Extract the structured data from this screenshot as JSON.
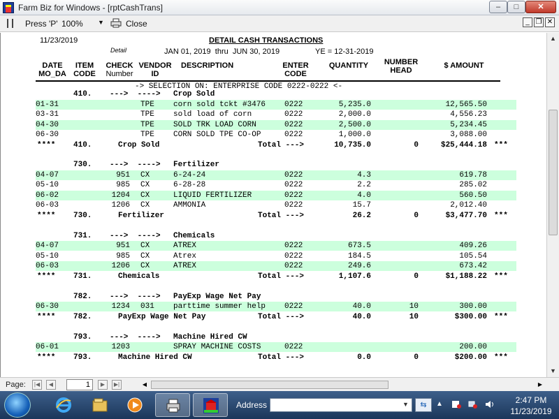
{
  "window": {
    "title": "Farm Biz for Windows - [rptCashTrans]",
    "min_glyph": "–",
    "max_glyph": "□",
    "close_glyph": "✕"
  },
  "toolbar": {
    "print_label": "Press 'P'",
    "zoom": "100%",
    "zoom_arrow": "▼",
    "close_label": "Close",
    "mdi_min": "_",
    "mdi_restore": "❐",
    "mdi_close": "✕"
  },
  "report": {
    "date": "11/23/2019",
    "title": "DETAIL CASH TRANSACTIONS",
    "detail_label": "Detail",
    "period": "JAN 01, 2019  thru  JUN 30, 2019",
    "ye": "YE = 12-31-2019",
    "headers": {
      "date": "DATE",
      "moda": "MO_DA",
      "item": "ITEM",
      "code": "CODE",
      "check": "CHECK",
      "number": "Number",
      "vendor": "VENDOR",
      "id": "ID",
      "description": "DESCRIPTION",
      "enter": "ENTER",
      "enter_code": "CODE",
      "quantity": "QUANTITY",
      "number_head_1": "NUMBER",
      "number_head_2": "HEAD",
      "amount": "$ AMOUNT"
    },
    "selection": "-> SELECTION ON: ENTERPRISE CODE 0222-0222 <-",
    "groups": [
      {
        "code": "410.",
        "arrows": "--->  ---->",
        "name": "Crop Sold",
        "rows": [
          {
            "date": "01-31",
            "check": "",
            "vendor": "TPE",
            "desc": "corn sold tckt #3476",
            "enter": "0222",
            "qty": "5,235.0",
            "head": "",
            "amount": "12,565.50",
            "band": true
          },
          {
            "date": "03-31",
            "check": "",
            "vendor": "TPE",
            "desc": "sold load of corn",
            "enter": "0222",
            "qty": "2,000.0",
            "head": "",
            "amount": "4,556.23",
            "band": false
          },
          {
            "date": "04-30",
            "check": "",
            "vendor": "TPE",
            "desc": "SOLD TRK LOAD CORN",
            "enter": "0222",
            "qty": "2,500.0",
            "head": "",
            "amount": "5,234.45",
            "band": true
          },
          {
            "date": "06-30",
            "check": "",
            "vendor": "TPE",
            "desc": "CORN SOLD TPE CO-OP",
            "enter": "0222",
            "qty": "1,000.0",
            "head": "",
            "amount": "3,088.00",
            "band": false
          }
        ],
        "total": {
          "stars": "****",
          "code": "410.",
          "name": "Crop Sold",
          "label": "Total --->",
          "qty": "10,735.0",
          "head": "0",
          "amount": "$25,444.18",
          "tail": "***"
        }
      },
      {
        "code": "730.",
        "arrows": "--->  ---->",
        "name": "Fertilizer",
        "rows": [
          {
            "date": "04-07",
            "check": "951",
            "vendor": "CX",
            "desc": "6-24-24",
            "enter": "0222",
            "qty": "4.3",
            "head": "",
            "amount": "619.78",
            "band": true
          },
          {
            "date": "05-10",
            "check": "985",
            "vendor": "CX",
            "desc": "6-28-28",
            "enter": "0222",
            "qty": "2.2",
            "head": "",
            "amount": "285.02",
            "band": false
          },
          {
            "date": "06-02",
            "check": "1204",
            "vendor": "CX",
            "desc": "LIQUID FERTILIZER",
            "enter": "0222",
            "qty": "4.0",
            "head": "",
            "amount": "560.50",
            "band": true
          },
          {
            "date": "06-03",
            "check": "1206",
            "vendor": "CX",
            "desc": "AMMONIA",
            "enter": "0222",
            "qty": "15.7",
            "head": "",
            "amount": "2,012.40",
            "band": false
          }
        ],
        "total": {
          "stars": "****",
          "code": "730.",
          "name": "Fertilizer",
          "label": "Total --->",
          "qty": "26.2",
          "head": "0",
          "amount": "$3,477.70",
          "tail": "***"
        }
      },
      {
        "code": "731.",
        "arrows": "--->  ---->",
        "name": "Chemicals",
        "rows": [
          {
            "date": "04-07",
            "check": "951",
            "vendor": "CX",
            "desc": "ATREX",
            "enter": "0222",
            "qty": "673.5",
            "head": "",
            "amount": "409.26",
            "band": true
          },
          {
            "date": "05-10",
            "check": "985",
            "vendor": "CX",
            "desc": "Atrex",
            "enter": "0222",
            "qty": "184.5",
            "head": "",
            "amount": "105.54",
            "band": false
          },
          {
            "date": "06-03",
            "check": "1206",
            "vendor": "CX",
            "desc": "ATREX",
            "enter": "0222",
            "qty": "249.6",
            "head": "",
            "amount": "673.42",
            "band": true
          }
        ],
        "total": {
          "stars": "****",
          "code": "731.",
          "name": "Chemicals",
          "label": "Total --->",
          "qty": "1,107.6",
          "head": "0",
          "amount": "$1,188.22",
          "tail": "***"
        }
      },
      {
        "code": "782.",
        "arrows": "--->  ---->",
        "name": "PayExp Wage Net Pay",
        "rows": [
          {
            "date": "06-30",
            "check": "1234",
            "vendor": "031",
            "desc": "parttime summer help",
            "enter": "0222",
            "qty": "40.0",
            "head": "10",
            "amount": "300.00",
            "band": true
          }
        ],
        "total": {
          "stars": "****",
          "code": "782.",
          "name": "PayExp Wage Net Pay",
          "label": "Total --->",
          "qty": "40.0",
          "head": "10",
          "amount": "$300.00",
          "tail": "***"
        }
      },
      {
        "code": "793.",
        "arrows": "--->  ---->",
        "name": "Machine Hired CW",
        "rows": [
          {
            "date": "06-01",
            "check": "1203",
            "vendor": "",
            "desc": "SPRAY MACHINE COSTS",
            "enter": "0222",
            "qty": "",
            "head": "",
            "amount": "200.00",
            "band": true
          }
        ],
        "total": {
          "stars": "****",
          "code": "793.",
          "name": "Machine Hired CW",
          "label": "Total --->",
          "qty": "0.0",
          "head": "0",
          "amount": "$200.00",
          "tail": "***"
        }
      }
    ]
  },
  "pagebar": {
    "label": "Page:",
    "page": "1",
    "first": "|◀",
    "prev": "◀",
    "next": "▶",
    "last": "▶|"
  },
  "taskbar": {
    "address_label": "Address",
    "address_value": "",
    "address_drop": "▼",
    "go_glyph": "⇆",
    "tray_up": "▲",
    "time": "2:47 PM",
    "date": "11/23/2019"
  },
  "colors": {
    "band": "#ccffdd",
    "taskbar": "#1b365a"
  }
}
